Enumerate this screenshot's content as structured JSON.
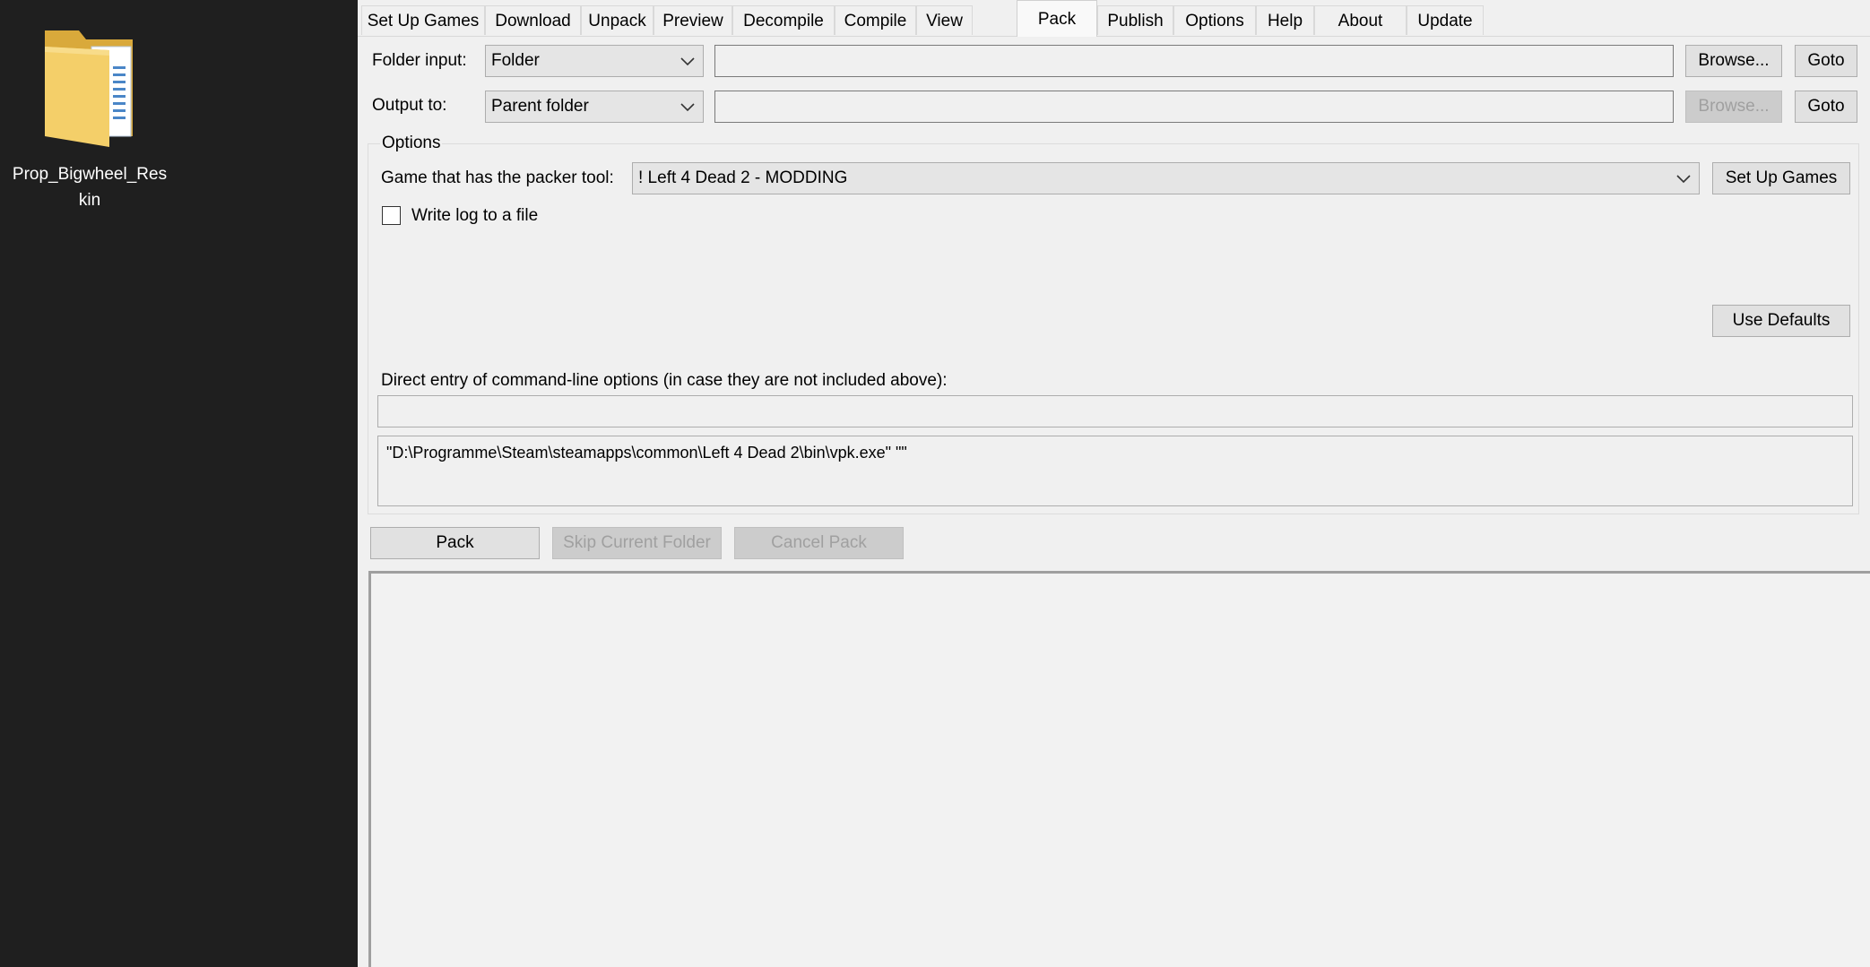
{
  "desktop": {
    "icon_label": "Prop_Bigwheel_Reskin",
    "icon_name": "folder-icon"
  },
  "tabs": [
    {
      "label": "Set Up Games",
      "active": false
    },
    {
      "label": "Download",
      "active": false
    },
    {
      "label": "Unpack",
      "active": false
    },
    {
      "label": "Preview",
      "active": false
    },
    {
      "label": "Decompile",
      "active": false
    },
    {
      "label": "Compile",
      "active": false
    },
    {
      "label": "View",
      "active": false
    },
    {
      "label": "Pack",
      "active": true
    },
    {
      "label": "Publish",
      "active": false
    },
    {
      "label": "Options",
      "active": false
    },
    {
      "label": "Help",
      "active": false
    },
    {
      "label": "About",
      "active": false
    },
    {
      "label": "Update",
      "active": false
    }
  ],
  "folder_input": {
    "label": "Folder input:",
    "mode": "Folder",
    "path": "",
    "browse_label": "Browse...",
    "goto_label": "Goto"
  },
  "output_to": {
    "label": "Output to:",
    "mode": "Parent folder",
    "path": "",
    "browse_label": "Browse...",
    "browse_disabled": true,
    "goto_label": "Goto"
  },
  "options": {
    "legend": "Options",
    "game_label": "Game that has the packer tool:",
    "game_value": "! Left 4 Dead 2 - MODDING",
    "setup_games_label": "Set Up Games",
    "write_log_label": "Write log to a file",
    "write_log_checked": false,
    "use_defaults_label": "Use Defaults",
    "direct_entry_label": "Direct entry of command-line options (in case they are not included above):",
    "direct_entry_value": "",
    "command_preview": "\"D:\\Programme\\Steam\\steamapps\\common\\Left 4 Dead 2\\bin\\vpk.exe\" \"\""
  },
  "actions": {
    "pack_label": "Pack",
    "skip_label": "Skip Current Folder",
    "cancel_label": "Cancel Pack"
  },
  "colors": {
    "window_bg": "#f0f0f0",
    "desktop_bg": "#1f1f1f",
    "disabled_text": "#a0a0a0"
  }
}
